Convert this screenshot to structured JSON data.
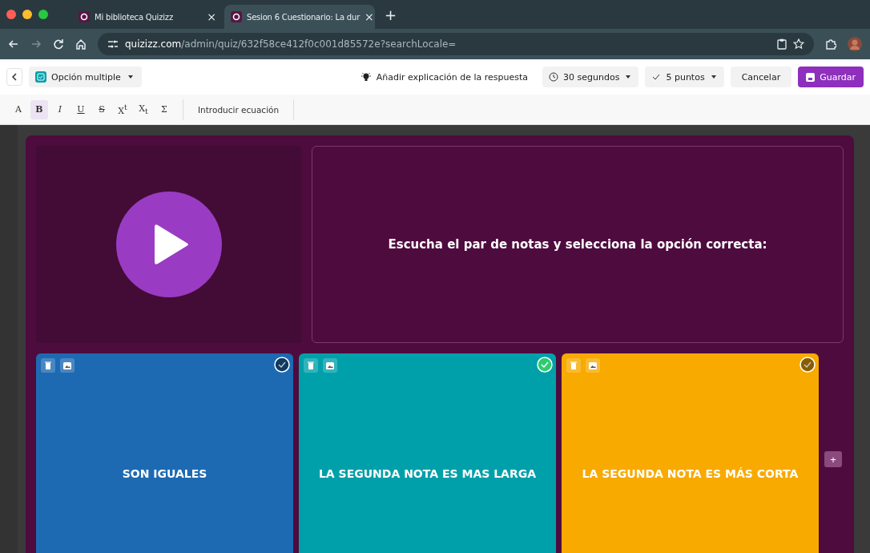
{
  "browser": {
    "tabs": [
      {
        "title": "Mi biblioteca Quizizz",
        "close": "×",
        "selected": false
      },
      {
        "title": "Sesion 6 Cuestionario: La dur",
        "close": "×",
        "selected": true
      }
    ],
    "new_tab": "+",
    "address": {
      "domain": "quizizz.com",
      "path": "/admin/quiz/632f58ce412f0c001d85572e?searchLocale="
    }
  },
  "toolbar": {
    "question_type": "Opción multiple",
    "explanation": "Añadir explicación de la respuesta",
    "time": "30 segundos",
    "points": "5 puntos",
    "cancel": "Cancelar",
    "save": "Guardar"
  },
  "format_bar": {
    "buttons": [
      {
        "label": "A",
        "selected": false
      },
      {
        "label": "B",
        "selected": true
      },
      {
        "label": "I",
        "selected": false
      },
      {
        "label": "U",
        "selected": false
      },
      {
        "label": "S",
        "selected": false
      },
      {
        "label": "X$^{t}$",
        "selected": false
      },
      {
        "label": "X$_{t}$",
        "selected": false
      },
      {
        "label": "Σ",
        "selected": false
      }
    ],
    "equation": "Introducir ecuación"
  },
  "question": {
    "text": "Escucha el par de notas y selecciona la opción correcta:"
  },
  "options": [
    {
      "text": "SON IGUALES",
      "color": "#1d6ab3",
      "correct": false
    },
    {
      "text": "LA SEGUNDA NOTA ES MAS LARGA",
      "color": "#00a0aa",
      "correct": true
    },
    {
      "text": "LA SEGUNDA NOTA ES MÁS CORTA",
      "color": "#f8aa00",
      "correct": false
    }
  ],
  "add_option": "+"
}
